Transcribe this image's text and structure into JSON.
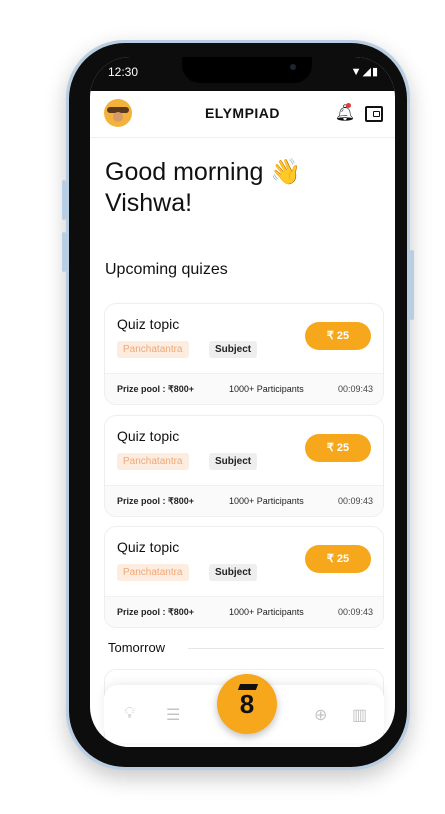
{
  "status_bar": {
    "time": "12:30",
    "icons": "▼◢▮"
  },
  "app_bar": {
    "title": "ELYMPIAD"
  },
  "greeting": {
    "line1": "Good morning",
    "wave": "👋",
    "line2": "Vishwa!"
  },
  "section": {
    "upcoming": "Upcoming quizes",
    "tomorrow": "Tomorrow"
  },
  "quizzes": [
    {
      "topic": "Quiz topic",
      "tag": "Panchatantra",
      "subject": "Subject",
      "price": "₹ 25",
      "prize_pool": "Prize pool : ₹800+",
      "participants": "1000+ Participants",
      "timer": "00:09:43"
    },
    {
      "topic": "Quiz topic",
      "tag": "Panchatantra",
      "subject": "Subject",
      "price": "₹ 25",
      "prize_pool": "Prize pool : ₹800+",
      "participants": "1000+ Participants",
      "timer": "00:09:43"
    },
    {
      "topic": "Quiz topic",
      "tag": "Panchatantra",
      "subject": "Subject",
      "price": "₹ 25",
      "prize_pool": "Prize pool : ₹800+",
      "participants": "1000+ Participants",
      "timer": "00:09:43"
    }
  ],
  "bottom_nav": {
    "icons": [
      "bulb-icon",
      "chat-icon",
      "home-logo-icon",
      "globe-icon",
      "leaderboard-icon"
    ],
    "fab_glyph": "8"
  },
  "colors": {
    "accent": "#f6a71b",
    "tag_bg": "#fdece0",
    "tag_text": "#f0a875",
    "frame": "#b9cee3"
  }
}
